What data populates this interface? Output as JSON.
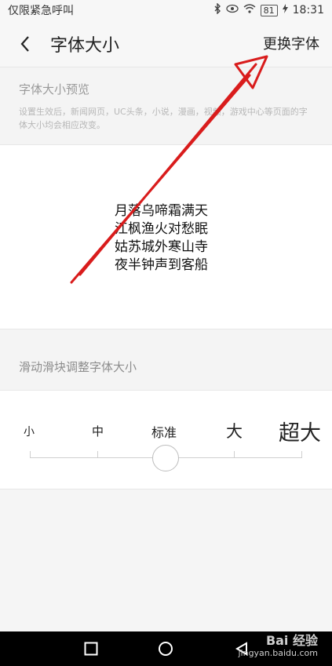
{
  "status_bar": {
    "left_text": "仅限紧急呼叫",
    "battery": "81",
    "time": "18:31"
  },
  "header": {
    "title": "字体大小",
    "action_label": "更换字体",
    "back_icon": "chevron-left-icon"
  },
  "preview": {
    "title": "字体大小预览",
    "description": "设置生效后，新闻网页，UC头条，小说，漫画，视频，游戏中心等页面的字体大小均会相应改变。",
    "poem": [
      "月落乌啼霜满天",
      "江枫渔火对愁眠",
      "姑苏城外寒山寺",
      "夜半钟声到客船"
    ]
  },
  "slider": {
    "title": "滑动滑块调整字体大小",
    "labels": [
      "小",
      "中",
      "标准",
      "大",
      "超大"
    ],
    "selected": "标准"
  },
  "nav": {
    "watermark_logo": "Bai 经验",
    "watermark_site": "jingyan.baidu.com"
  },
  "colors": {
    "annotation_arrow": "#d91c1c",
    "background": "#f5f5f5"
  }
}
